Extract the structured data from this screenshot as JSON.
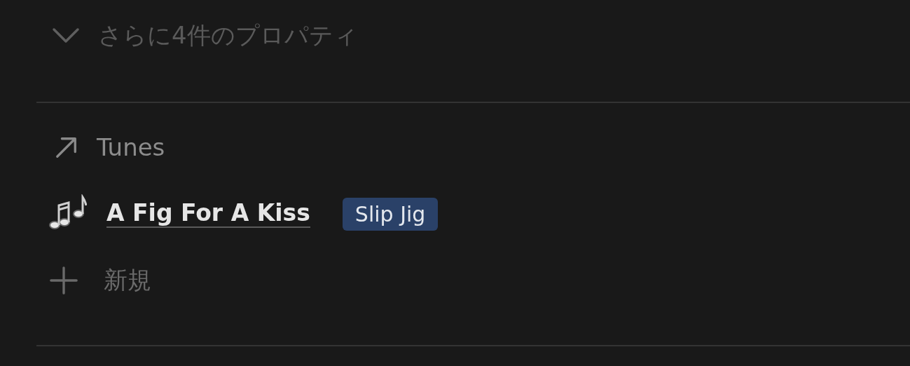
{
  "more_properties": {
    "label": "さらに4件のプロパティ",
    "expanded": false
  },
  "relation": {
    "label": "Tunes",
    "items": [
      {
        "title": "A Fig For A Kiss",
        "tag": {
          "label": "Slip Jig",
          "color": "#2a4168"
        }
      }
    ],
    "new_label": "新規"
  }
}
